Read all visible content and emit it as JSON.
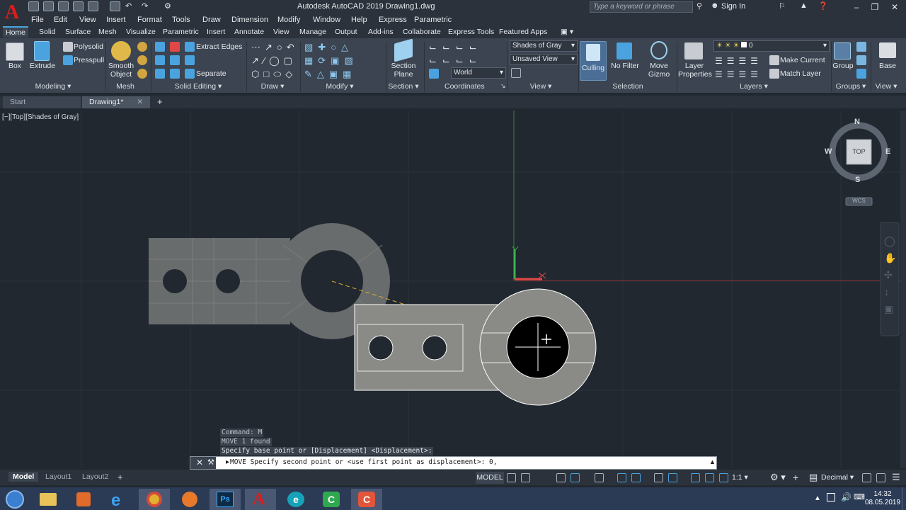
{
  "titlebar": {
    "title": "Autodesk AutoCAD 2019    Drawing1.dwg",
    "search_placeholder": "Type a keyword or phrase",
    "signin": "Sign In"
  },
  "menu": [
    "File",
    "Edit",
    "View",
    "Insert",
    "Format",
    "Tools",
    "Draw",
    "Dimension",
    "Modify",
    "Window",
    "Help",
    "Express",
    "Parametric"
  ],
  "ribbon_tabs": [
    "Home",
    "Solid",
    "Surface",
    "Mesh",
    "Visualize",
    "Parametric",
    "Insert",
    "Annotate",
    "View",
    "Manage",
    "Output",
    "Add-ins",
    "Collaborate",
    "Express Tools",
    "Featured Apps"
  ],
  "ribbon": {
    "box": "Box",
    "extrude": "Extrude",
    "polysolid": "Polysolid",
    "presspull": "Presspull",
    "smooth_object_1": "Smooth",
    "smooth_object_2": "Object",
    "extract_edges": "Extract Edges",
    "separate": "Separate",
    "section_plane_1": "Section",
    "section_plane_2": "Plane",
    "visual_style": "Shades of Gray",
    "saved_view": "Unsaved View",
    "ucs": "World",
    "culling": "Culling",
    "no_filter": "No Filter",
    "move_gizmo_1": "Move",
    "move_gizmo_2": "Gizmo",
    "layer_props_1": "Layer",
    "layer_props_2": "Properties",
    "layer_current": "0",
    "make_current": "Make Current",
    "match_layer": "Match Layer",
    "group": "Group",
    "base": "Base"
  },
  "panels": [
    "Modeling",
    "Mesh",
    "Solid Editing",
    "Draw",
    "Modify",
    "Section",
    "Coordinates",
    "View",
    "Selection",
    "Layers",
    "Groups",
    "View"
  ],
  "file_tabs": [
    "Start",
    "Drawing1*"
  ],
  "viewport_label": "[−][Top][Shades of Gray]",
  "viewcube": {
    "n": "N",
    "s": "S",
    "e": "E",
    "w": "W",
    "face": "TOP",
    "wcs": "WCS"
  },
  "command_history": [
    "Command: M",
    "MOVE 1 found",
    "Specify base point or [Displacement] <Displacement>:"
  ],
  "command_line": "MOVE Specify second point or <use first point as displacement>: 0,",
  "layout_tabs": [
    "Model",
    "Layout1",
    "Layout2"
  ],
  "status": {
    "model": "MODEL",
    "scale": "1:1",
    "units": "Decimal"
  },
  "clock": {
    "time": "14:32",
    "date": "08.05.2019"
  },
  "colors": {
    "accent": "#4aa3df",
    "background": "#212830",
    "ribbon": "#3b4450",
    "solid_fill": "#8a8a86"
  }
}
